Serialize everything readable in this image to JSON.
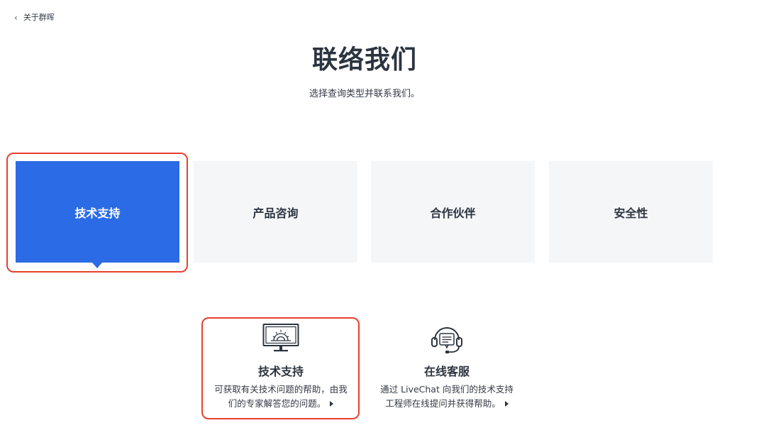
{
  "nav": {
    "back_label": "关于群晖",
    "back_icon": "chevron-left-icon"
  },
  "header": {
    "title": "联络我们",
    "subtitle": "选择查询类型并联系我们。"
  },
  "categories": [
    {
      "label": "技术支持",
      "selected": true
    },
    {
      "label": "产品咨询",
      "selected": false
    },
    {
      "label": "合作伙伴",
      "selected": false
    },
    {
      "label": "安全性",
      "selected": false
    }
  ],
  "options": [
    {
      "icon": "monitor-gear-icon",
      "title": "技术支持",
      "desc_line1": "可获取有关技术问题的帮助，由我",
      "desc_line2": "们的专家解答您的问题。"
    },
    {
      "icon": "headset-icon",
      "title": "在线客服",
      "desc_line1": "通过 LiveChat 向我们的技术支持",
      "desc_line2": "工程师在线提问并获得帮助。"
    }
  ],
  "colors": {
    "accent": "#2b6be6",
    "highlight": "#e8402f",
    "tab_bg": "#f5f6f8",
    "text": "#2c3440"
  }
}
